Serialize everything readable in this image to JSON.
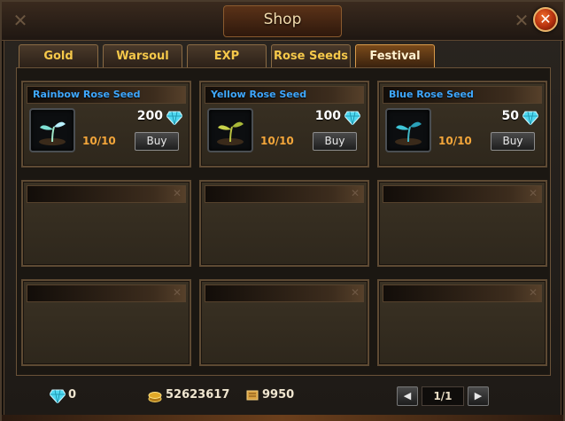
{
  "window": {
    "title": "Shop"
  },
  "tabs": [
    {
      "label": "Gold",
      "active": false
    },
    {
      "label": "Warsoul",
      "active": false
    },
    {
      "label": "EXP",
      "active": false
    },
    {
      "label": "Rose Seeds",
      "active": false
    },
    {
      "label": "Festival",
      "active": true
    }
  ],
  "items": [
    {
      "name": "Rainbow Rose Seed",
      "price": "200",
      "stock": "10/10",
      "buy_label": "Buy",
      "icon": "rainbow-seed-icon",
      "leaf_color": "#7fe0d4"
    },
    {
      "name": "Yellow Rose Seed",
      "price": "100",
      "stock": "10/10",
      "buy_label": "Buy",
      "icon": "yellow-seed-icon",
      "leaf_color": "#c8d24a"
    },
    {
      "name": "Blue Rose Seed",
      "price": "50",
      "stock": "10/10",
      "buy_label": "Buy",
      "icon": "blue-seed-icon",
      "leaf_color": "#3ec6d8"
    }
  ],
  "footer": {
    "diamonds": "0",
    "gold": "52623617",
    "honor": "9950",
    "page": "1/1"
  },
  "colors": {
    "item_name": "#3fa8ff",
    "stock": "#f3a63a",
    "tab_text": "#f5c84a",
    "diamond": "#4fd8f0"
  }
}
